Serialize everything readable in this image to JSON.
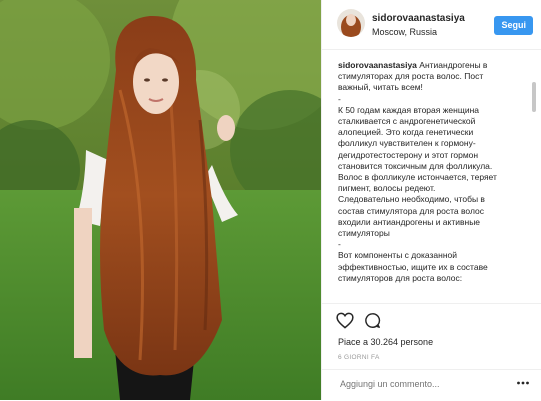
{
  "header": {
    "username": "sidorovaanastasiya",
    "location": "Moscow, Russia",
    "follow_label": "Segui"
  },
  "caption": {
    "username": "sidorovaanastasiya",
    "lines": [
      "Антиандрогены в",
      "стимуляторах для роста волос. Пост",
      "важный, читать всем!",
      "-",
      "К 50 годам каждая вторая женщина",
      "сталкивается с андрогенетической",
      "алопецией. Это когда генетически",
      "фолликул чувствителен к гормону-",
      "дегидротестостерону и этот гормон",
      "становится токсичным для фолликула.",
      "Волос в фолликуле истончается, теряет",
      "пигмент, волосы редеют.",
      "Следовательно необходимо, чтобы в",
      "состав стимулятора для роста волос",
      "входили антиандрогены и активные",
      "стимуляторы",
      "-",
      "Вот компоненты с доказанной",
      "эффективностью, ищите их в составе",
      "стимуляторов для роста волос:"
    ]
  },
  "actions": {
    "likes_text": "Piace a 30.264 persone",
    "time_ago": "6 GIORNI FA"
  },
  "comment": {
    "placeholder": "Aggiungi un commento..."
  },
  "icons": {
    "like": "heart-icon",
    "comment": "speech-bubble-icon",
    "more": "ellipsis-icon"
  },
  "colors": {
    "follow_button": "#3897f0",
    "secondary_text": "#999999",
    "border": "#efefef"
  }
}
